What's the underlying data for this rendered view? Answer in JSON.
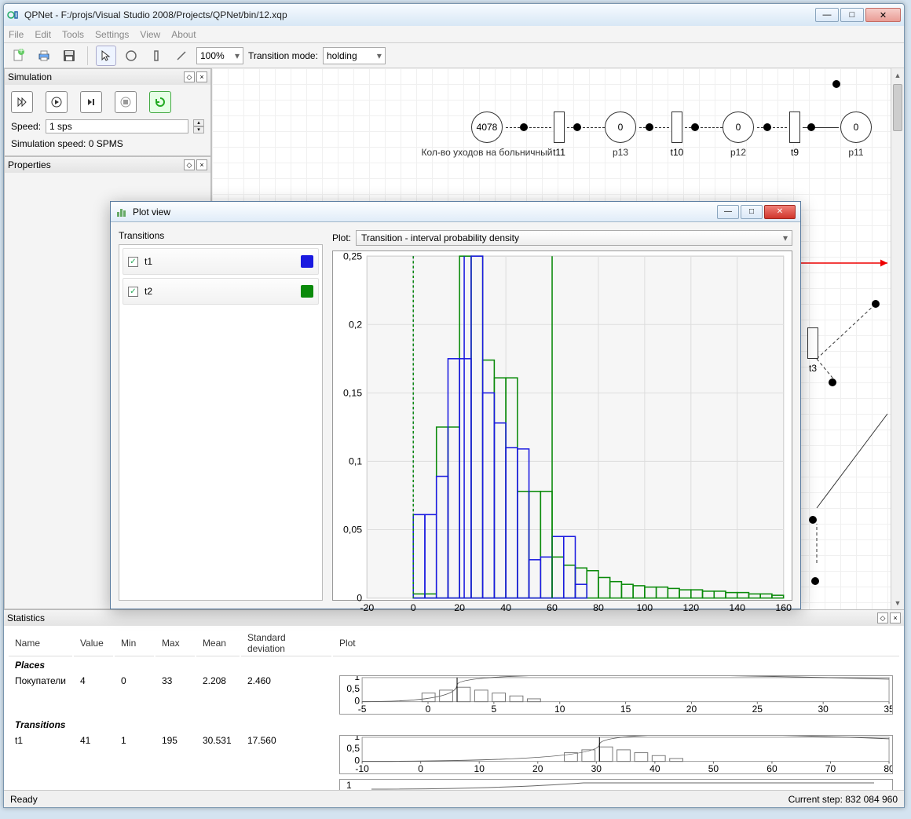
{
  "window": {
    "title": "QPNet - F:/projs/Visual Studio 2008/Projects/QPNet/bin/12.xqp"
  },
  "menu": {
    "file": "File",
    "edit": "Edit",
    "tools": "Tools",
    "settings": "Settings",
    "view": "View",
    "about": "About"
  },
  "toolbar": {
    "zoom": "100%",
    "trans_mode_label": "Transition mode:",
    "trans_mode_value": "holding"
  },
  "simulation": {
    "title": "Simulation",
    "speed_label": "Speed:",
    "speed_value": "1 sps",
    "sim_speed_text": "Simulation speed: 0 SPMS"
  },
  "properties": {
    "title": "Properties"
  },
  "petri": {
    "place_value_4078": "4078",
    "place_value_0": "0",
    "place_caption": "Кол-во уходов на больничный",
    "labels": {
      "t11": "t11",
      "p13": "p13",
      "t10": "t10",
      "p12": "p12",
      "t9": "t9",
      "p11": "p11",
      "t3": "t3"
    }
  },
  "plotview": {
    "title": "Plot view",
    "transitions_label": "Transitions",
    "items": [
      {
        "name": "t1",
        "checked": true,
        "color": "#1a1ae0"
      },
      {
        "name": "t2",
        "checked": true,
        "color": "#0a8a0a"
      }
    ],
    "plot_label": "Plot:",
    "plot_value": "Transition - interval probability density"
  },
  "chart_data": {
    "type": "bar",
    "xlabel": "",
    "ylabel": "",
    "xlim": [
      -20,
      160
    ],
    "ylim": [
      0,
      0.25
    ],
    "xticks": [
      -20,
      0,
      20,
      40,
      60,
      80,
      100,
      120,
      140,
      160
    ],
    "yticks": [
      0,
      0.05,
      0.1,
      0.15,
      0.2,
      0.25
    ],
    "series": [
      {
        "name": "t1",
        "color": "#1a1ae0",
        "bin_start": 0,
        "bin_width": 5,
        "values": [
          0.061,
          0.061,
          0.089,
          0.175,
          0.175,
          0.25,
          0.15,
          0.128,
          0.11,
          0.109,
          0.028,
          0.03,
          0.045,
          0.045,
          0.01
        ]
      },
      {
        "name": "t2",
        "color": "#0a8a0a",
        "bin_start": 0,
        "bin_width": 5,
        "values": [
          0.003,
          0.003,
          0.125,
          0.125,
          0.25,
          0.25,
          0.174,
          0.161,
          0.161,
          0.078,
          0.078,
          0.078,
          0.03,
          0.024,
          0.022,
          0.02,
          0.015,
          0.012,
          0.01,
          0.009,
          0.008,
          0.008,
          0.007,
          0.006,
          0.006,
          0.005,
          0.005,
          0.004,
          0.004,
          0.003,
          0.003,
          0.002
        ]
      }
    ],
    "vlines_t1": [
      0,
      22
    ],
    "vlines_t2": [
      0,
      60
    ]
  },
  "statistics": {
    "title": "Statistics",
    "columns": [
      "Name",
      "Value",
      "Min",
      "Max",
      "Mean",
      "Standard deviation",
      "Plot"
    ],
    "cat_places": "Places",
    "cat_transitions": "Transitions",
    "rows": [
      {
        "name": "Покупатели",
        "value": "4",
        "min": "0",
        "max": "33",
        "mean": "2.208",
        "std": "2.460",
        "mini": {
          "xlim": [
            -5,
            35
          ],
          "xticks": [
            -5,
            0,
            5,
            10,
            15,
            20,
            25,
            30,
            35
          ],
          "mean_x": 2.208,
          "ymax": 1,
          "yticks": [
            0,
            0.5,
            1
          ]
        }
      },
      {
        "name": "t1",
        "value": "41",
        "min": "1",
        "max": "195",
        "mean": "30.531",
        "std": "17.560",
        "mini": {
          "xlim": [
            -10,
            80
          ],
          "xticks": [
            -10,
            0,
            10,
            20,
            30,
            40,
            50,
            60,
            70,
            80
          ],
          "mean_x": 30.531,
          "ymax": 1,
          "yticks": [
            0,
            0.5,
            1
          ]
        }
      }
    ]
  },
  "statusbar": {
    "ready": "Ready",
    "step_label": "Current step: 832 084 960"
  }
}
